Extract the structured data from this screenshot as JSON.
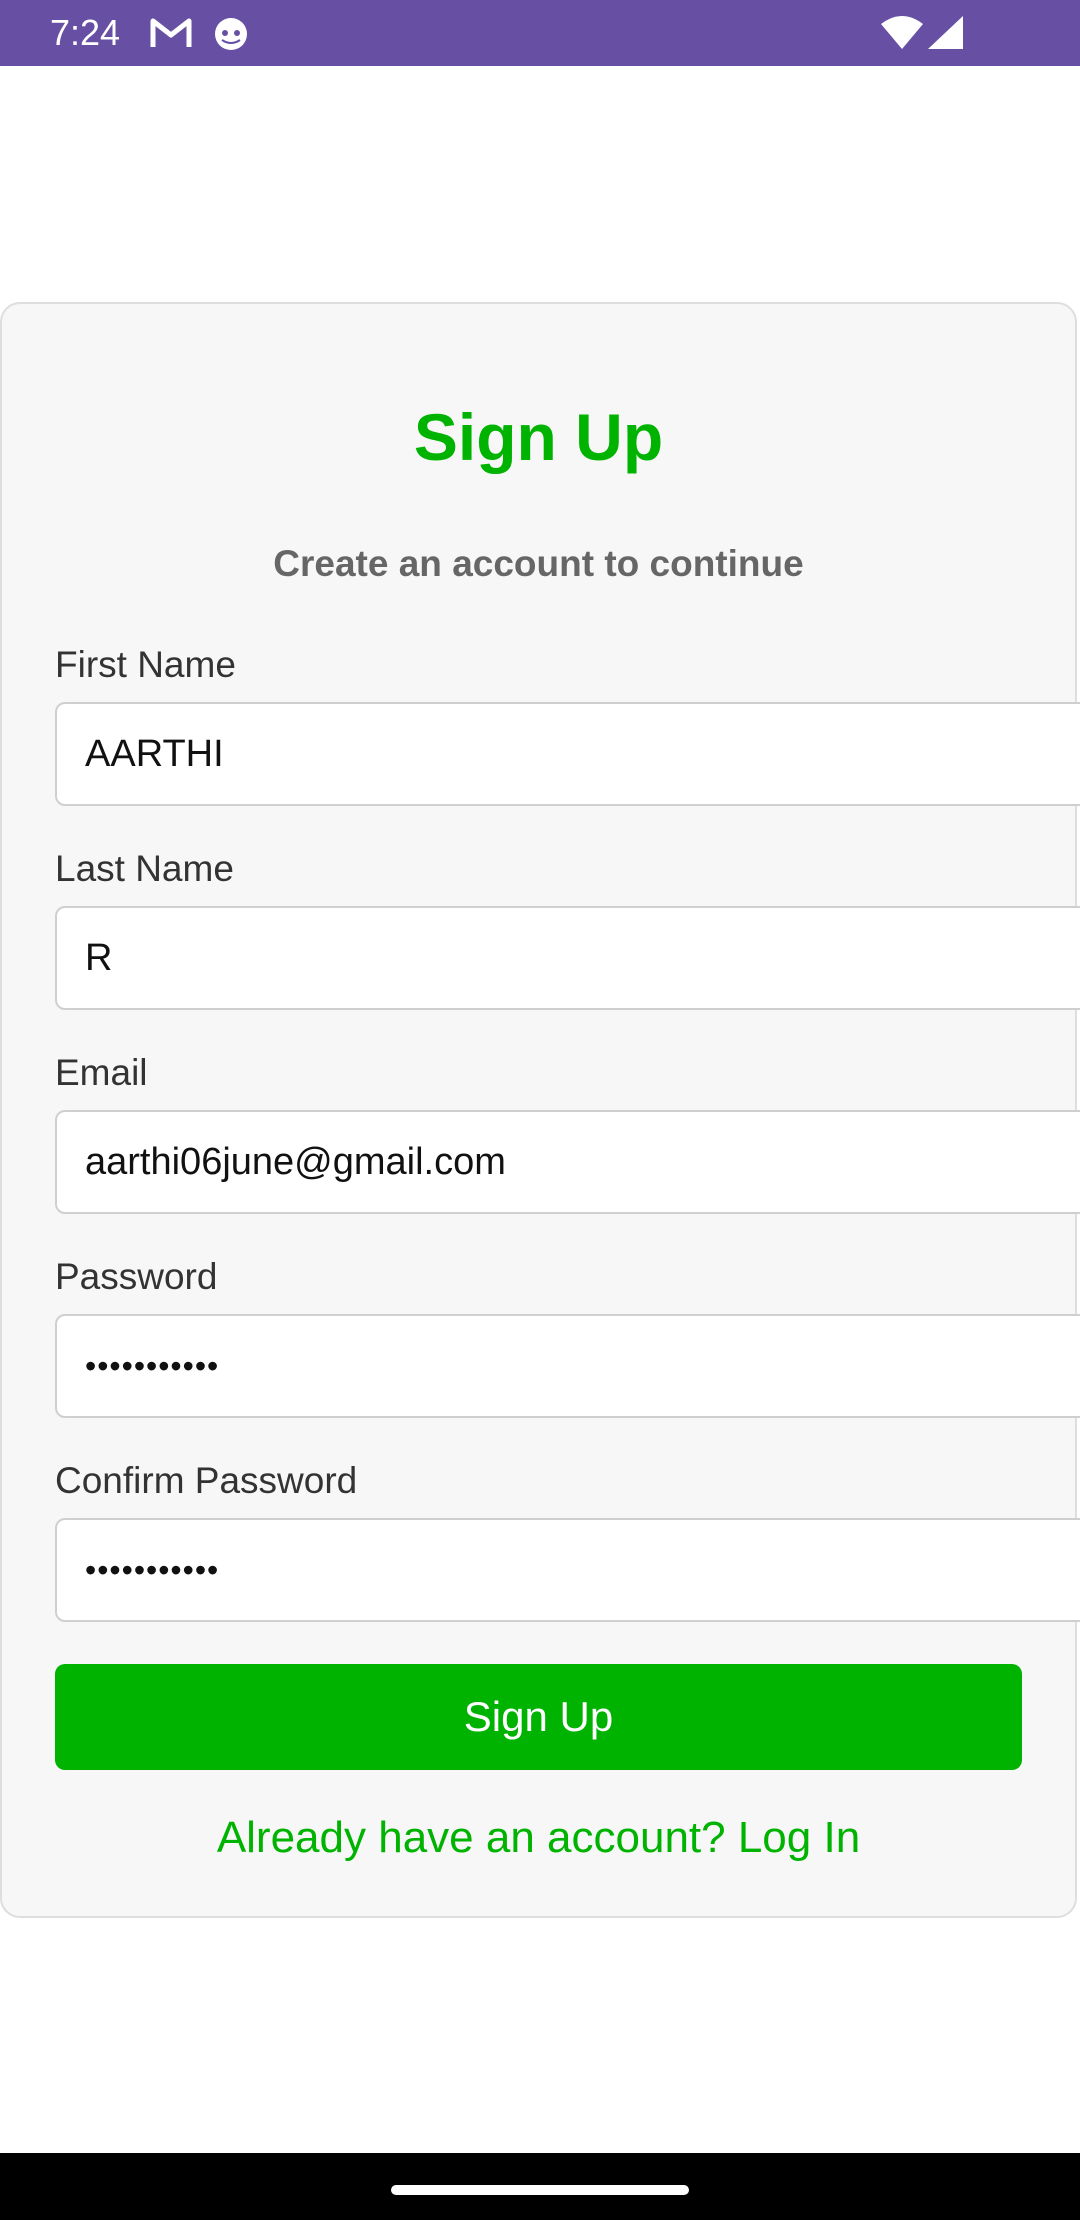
{
  "status_bar": {
    "time": "7:24",
    "background_color": "#6750a4",
    "icons": [
      "gmail-icon",
      "android-robot-icon",
      "wifi-icon",
      "cell-signal-icon"
    ]
  },
  "form": {
    "title": "Sign Up",
    "subtitle": "Create an account to continue",
    "fields": [
      {
        "label": "First Name",
        "value": "AARTHI",
        "type": "text"
      },
      {
        "label": "Last Name",
        "value": "R",
        "type": "text"
      },
      {
        "label": "Email",
        "value": "aarthi06june@gmail.com",
        "type": "email"
      },
      {
        "label": "Password",
        "value": "•••••••••••",
        "type": "password"
      },
      {
        "label": "Confirm Password",
        "value": "•••••••••••",
        "type": "password"
      }
    ],
    "submit_label": "Sign Up",
    "login_link": "Already have an account? Log In"
  },
  "colors": {
    "accent": "#00b300",
    "card_background": "#f7f7f7",
    "subtitle": "#666666"
  }
}
